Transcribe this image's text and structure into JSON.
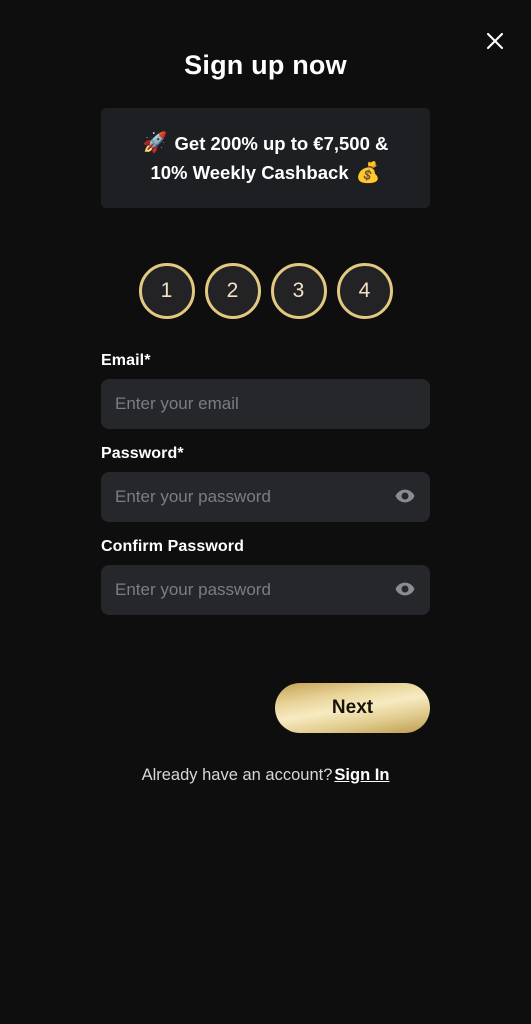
{
  "header": {
    "title": "Sign up now",
    "close_icon": "close-icon"
  },
  "promo": {
    "line1_emoji": "🚀",
    "line1_text": "Get 200% up to €7,500 &",
    "line2_text": "10% Weekly Cashback",
    "line2_emoji": "💰"
  },
  "steps": {
    "items": [
      {
        "label": "1"
      },
      {
        "label": "2"
      },
      {
        "label": "3"
      },
      {
        "label": "4"
      }
    ]
  },
  "form": {
    "email": {
      "label": "Email",
      "required_mark": "*",
      "placeholder": "Enter your email",
      "value": ""
    },
    "password": {
      "label": "Password",
      "required_mark": "*",
      "placeholder": "Enter your password",
      "value": "",
      "toggle_icon": "eye-icon"
    },
    "confirm_password": {
      "label": "Confirm Password",
      "required_mark": "",
      "placeholder": "Enter your password",
      "value": "",
      "toggle_icon": "eye-icon"
    },
    "submit_label": "Next"
  },
  "footer": {
    "prompt": "Already have an account?",
    "link_label": "Sign In"
  },
  "colors": {
    "background": "#0e0e0f",
    "banner_bg": "#1e1f23",
    "input_bg": "#26272b",
    "gold": "#e3c882",
    "gold_text": "#efe3c4",
    "placeholder": "#7b7d84"
  }
}
